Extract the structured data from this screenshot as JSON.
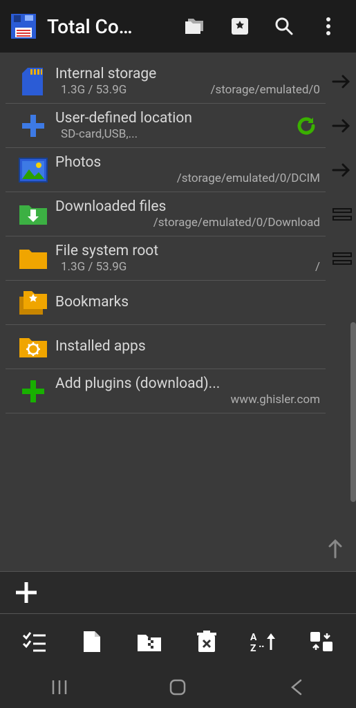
{
  "appbar": {
    "title": "Total Co…"
  },
  "items": [
    {
      "title": "Internal storage",
      "sub_left": "1.3G / 53.9G",
      "sub_right": "/storage/emulated/0",
      "side": "arrow"
    },
    {
      "title": "User-defined location",
      "sub_left": "SD-card,USB,...",
      "sub_right": "",
      "refresh": true,
      "side": "arrow"
    },
    {
      "title": "Photos",
      "sub_left": "",
      "sub_right": "/storage/emulated/0/DCIM",
      "side": "arrow"
    },
    {
      "title": "Downloaded files",
      "sub_left": "",
      "sub_right": "/storage/emulated/0/Download",
      "side": "split"
    },
    {
      "title": "File system root",
      "sub_left": "1.3G / 53.9G",
      "sub_right": "/",
      "side": "split"
    },
    {
      "title": "Bookmarks",
      "sub_left": "",
      "sub_right": ""
    },
    {
      "title": "Installed apps",
      "sub_left": "",
      "sub_right": ""
    },
    {
      "title": "Add plugins (download)...",
      "sub_left": "",
      "sub_right": "www.ghisler.com"
    }
  ]
}
